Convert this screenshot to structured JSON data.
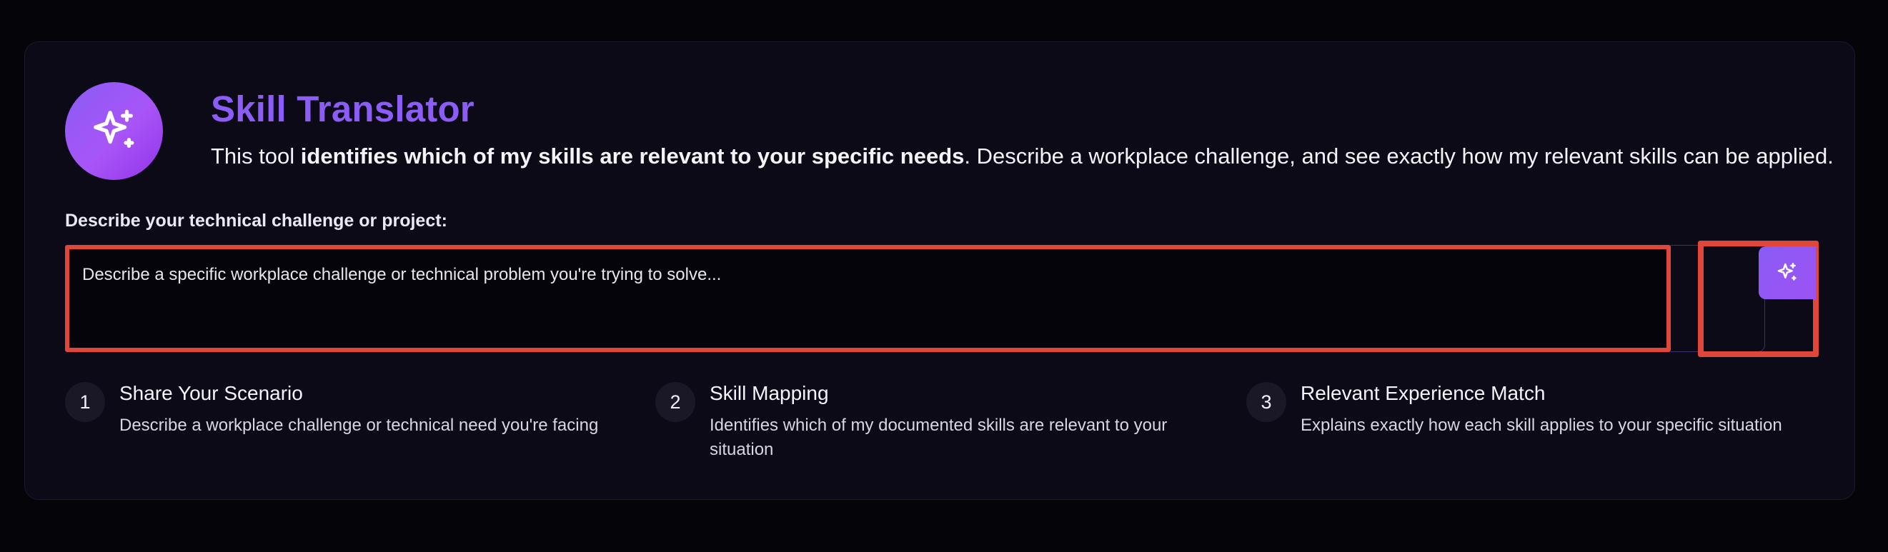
{
  "header": {
    "title": "Skill Translator",
    "desc_prefix": "This tool ",
    "desc_bold": "identifies which of my skills are relevant to your specific needs",
    "desc_suffix": ". Describe a workplace challenge, and see exactly how my relevant skills can be applied.",
    "logo_icon": "sparkles-icon"
  },
  "form": {
    "label": "Describe your technical challenge or project:",
    "placeholder": "Describe a specific workplace challenge or technical problem you're trying to solve...",
    "value": "",
    "submit_icon": "sparkles-icon"
  },
  "steps": [
    {
      "number": "1",
      "title": "Share Your Scenario",
      "description": "Describe a workplace challenge or technical need you're facing"
    },
    {
      "number": "2",
      "title": "Skill Mapping",
      "description": "Identifies which of my documented skills are relevant to your situation"
    },
    {
      "number": "3",
      "title": "Relevant Experience Match",
      "description": "Explains exactly how each skill applies to your specific situation"
    }
  ],
  "colors": {
    "accent": "#8b5cf6",
    "highlight_box": "#e0473a",
    "card_bg": "#0c0a17",
    "page_bg": "#050409"
  }
}
